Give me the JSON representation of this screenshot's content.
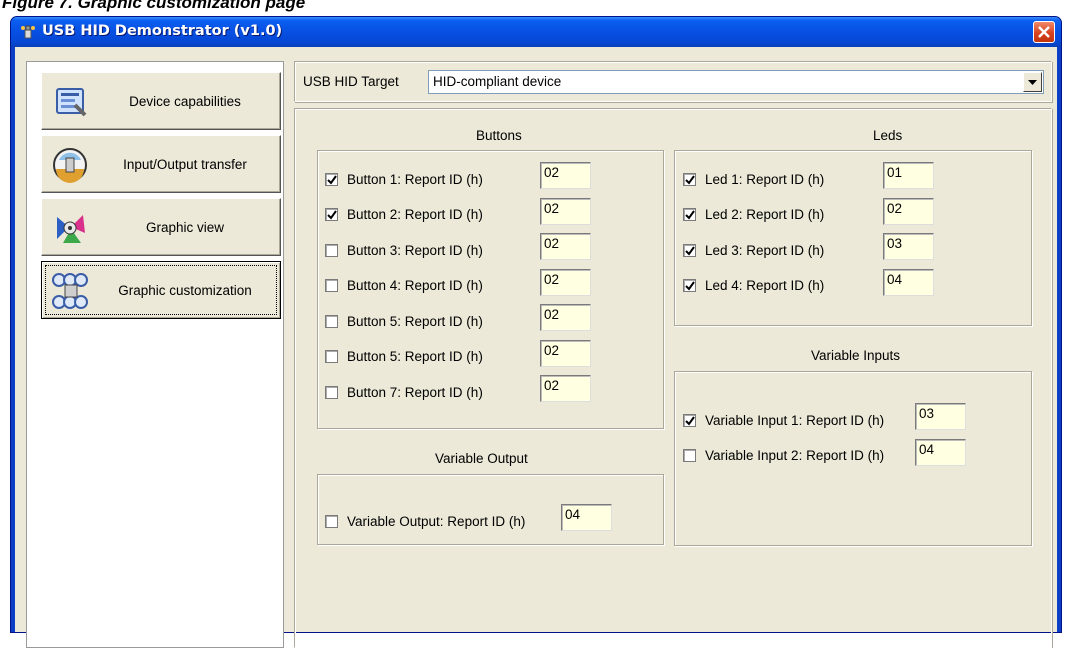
{
  "window": {
    "title": "USB HID Demonstrator (v1.0)"
  },
  "page_header_cropped": "Figure 7.   Graphic customization page",
  "nav": [
    {
      "label": "Device capabilities",
      "active": false
    },
    {
      "label": "Input/Output transfer",
      "active": false
    },
    {
      "label": "Graphic view",
      "active": false
    },
    {
      "label": "Graphic customization",
      "active": true
    }
  ],
  "target": {
    "label": "USB HID Target",
    "value": "HID-compliant device"
  },
  "buttons": {
    "title": "Buttons",
    "items": [
      {
        "label": "Button 1:  Report ID (h)",
        "checked": true,
        "value": "02"
      },
      {
        "label": "Button 2:  Report ID (h)",
        "checked": true,
        "value": "02"
      },
      {
        "label": "Button 3:  Report ID (h)",
        "checked": false,
        "value": "02"
      },
      {
        "label": "Button 4:  Report ID (h)",
        "checked": false,
        "value": "02"
      },
      {
        "label": "Button 5:  Report ID (h)",
        "checked": false,
        "value": "02"
      },
      {
        "label": "Button 5:  Report ID (h)",
        "checked": false,
        "value": "02"
      },
      {
        "label": "Button 7:  Report ID (h)",
        "checked": false,
        "value": "02"
      }
    ]
  },
  "leds": {
    "title": "Leds",
    "items": [
      {
        "label": "Led 1:  Report ID (h)",
        "checked": true,
        "value": "01"
      },
      {
        "label": "Led 2:  Report ID (h)",
        "checked": true,
        "value": "02"
      },
      {
        "label": "Led 3:  Report ID (h)",
        "checked": true,
        "value": "03"
      },
      {
        "label": "Led 4:  Report ID (h)",
        "checked": true,
        "value": "04"
      }
    ]
  },
  "variable_output": {
    "title": "Variable Output",
    "items": [
      {
        "label": "Variable Output: Report ID (h)",
        "checked": false,
        "value": "04"
      }
    ]
  },
  "variable_inputs": {
    "title": "Variable Inputs",
    "items": [
      {
        "label": "Variable Input 1: Report ID (h)",
        "checked": true,
        "value": "03"
      },
      {
        "label": "Variable Input 2: Report ID (h)",
        "checked": false,
        "value": "04"
      }
    ]
  },
  "colors": {
    "titlebar": "#0750e3",
    "client": "#ece9d8",
    "field": "#ffffe1",
    "close": "#d8431e"
  },
  "icons": {
    "app": "usb-plug-icon",
    "close": "close-icon",
    "dropdown": "chevron-down-icon",
    "nav": [
      "device-capabilities-icon",
      "input-output-icon",
      "graphic-view-icon",
      "graphic-customization-icon"
    ]
  }
}
